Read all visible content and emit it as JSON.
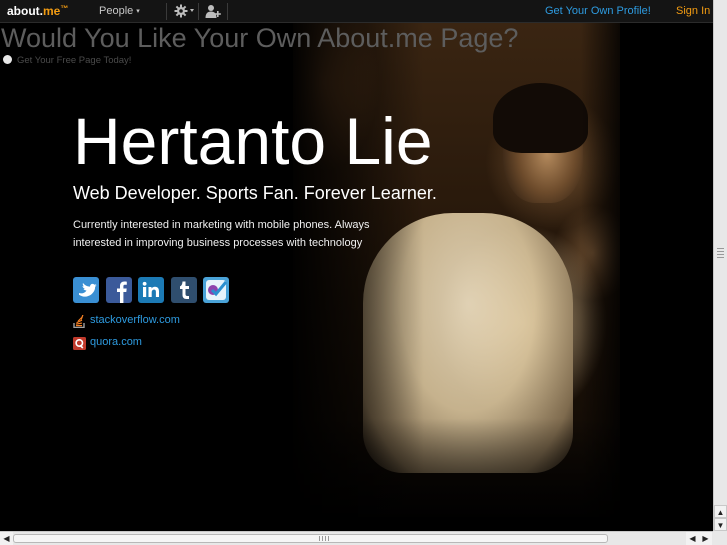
{
  "topbar": {
    "logo_main": "about.",
    "logo_me": "me",
    "logo_tm": "™",
    "people_label": "People",
    "people_caret": "▾",
    "get_own_profile": "Get Your Own Profile!",
    "sign_in": "Sign In"
  },
  "banner": {
    "title": "Would You Like Your Own About.me Page?",
    "link": "Get Your Free Page Today!"
  },
  "profile": {
    "name": "Hertanto Lie",
    "headline": "Web Developer. Sports Fan. Forever Learner.",
    "bio": "Currently interested in marketing with mobile phones. Always interested in improving business processes with technology"
  },
  "social_icons": [
    "twitter-icon",
    "facebook-icon",
    "linkedin-icon",
    "tumblr-icon",
    "foursquare-icon"
  ],
  "links": [
    {
      "icon": "stackoverflow-icon",
      "label": "stackoverflow.com"
    },
    {
      "icon": "quora-icon",
      "label": "quora.com"
    }
  ],
  "colors": {
    "accent_orange": "#f39c12",
    "link_blue": "#2e9be0",
    "twitter": "#3a8fd3",
    "facebook": "#3b5a9a",
    "linkedin": "#1c7ab5",
    "tumblr": "#2f4e6e",
    "foursquare": "#4aa3d8"
  }
}
